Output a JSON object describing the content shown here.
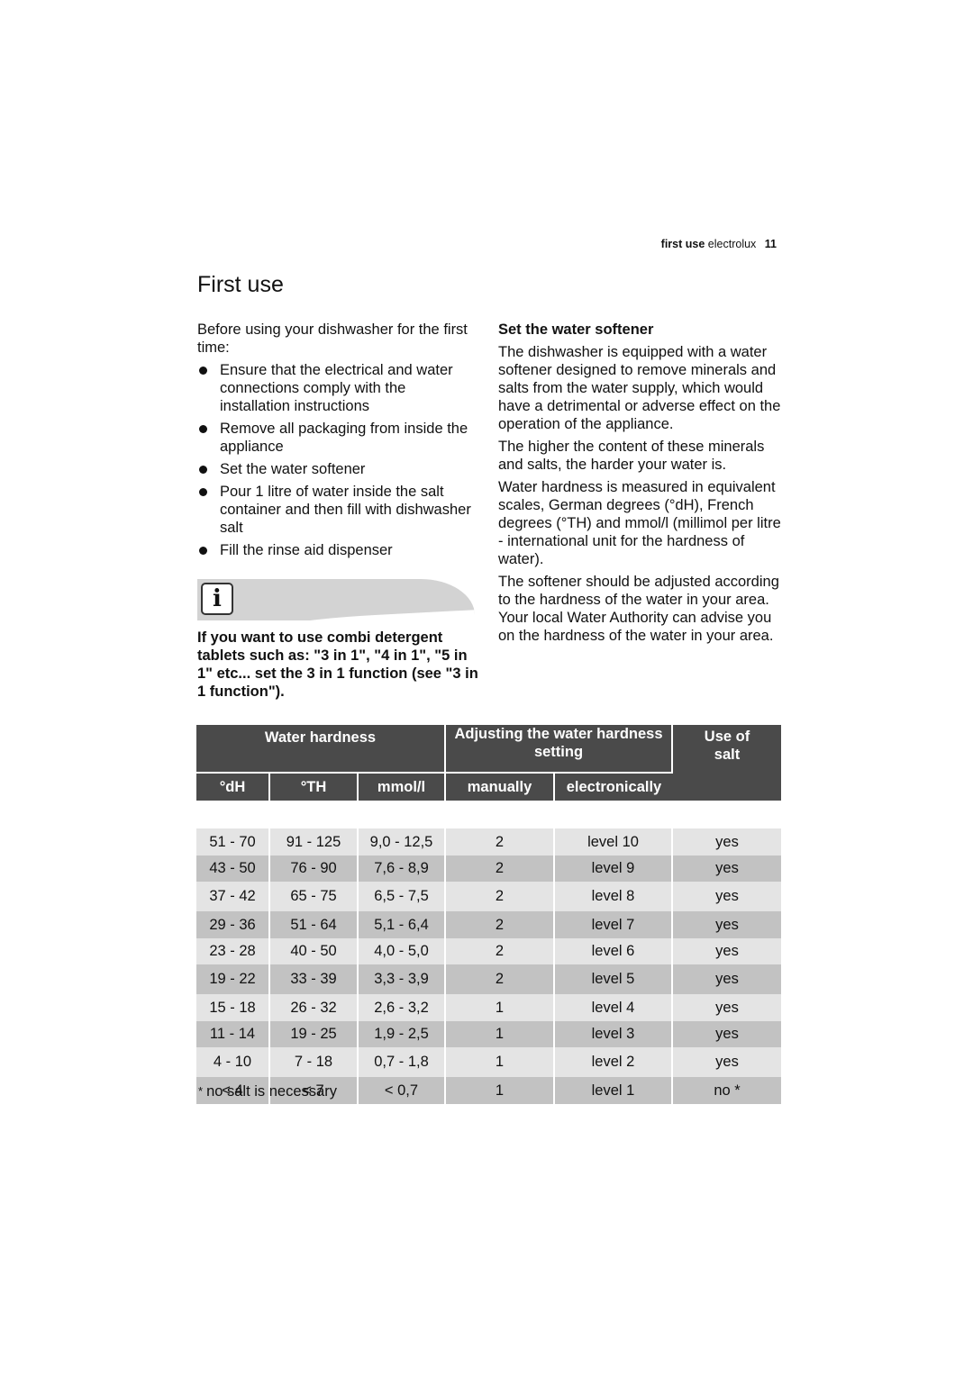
{
  "running_header": {
    "section": "first use",
    "brand": "electrolux",
    "page_number": "11"
  },
  "page_title": "First use",
  "left_column": {
    "intro": "Before using your dishwasher for the first time:",
    "bullets": [
      "Ensure that the electrical and water connections comply with the installation instructions",
      "Remove all packaging from inside the appliance",
      "Set the water softener",
      "Pour 1 litre of water inside the salt container and then fill with dishwasher salt",
      "Fill the rinse aid dispenser"
    ],
    "info_icon": "info-icon",
    "note": "If you want to use combi detergent tablets such as: \"3 in 1\", \"4 in 1\", \"5 in 1\" etc... set the 3 in 1 function (see \"3 in 1 function\")."
  },
  "right_column": {
    "heading": "Set the water softener",
    "paragraphs": [
      "The dishwasher is equipped with a water softener designed to remove minerals and salts from the water supply, which would have a detrimental or adverse effect on the operation of the appliance.",
      "The higher the content of these minerals and salts, the harder your water is.",
      "Water hardness is measured in equivalent scales, German degrees (°dH), French degrees (°TH) and mmol/l (millimol per litre - international unit for the hardness of water).",
      "The softener should be adjusted according to the hardness of the water in your area. Your local Water Authority can advise you on the hardness of the water in your area."
    ]
  },
  "table": {
    "group_headers": {
      "water_hardness": "Water hardness",
      "adjusting": "Adjusting the water hardness setting",
      "use_of_salt": "Use of salt"
    },
    "sub_headers": {
      "dh": "°dH",
      "th": "°TH",
      "mmol": "mmol/l",
      "manually": "manually",
      "electronically": "electronically"
    },
    "rows": [
      {
        "dh": "51 - 70",
        "th": "91 - 125",
        "mmol": "9,0 - 12,5",
        "manually": "2",
        "electronically": "level 10",
        "salt": "yes"
      },
      {
        "dh": "43 - 50",
        "th": "76 - 90",
        "mmol": "7,6 - 8,9",
        "manually": "2",
        "electronically": "level 9",
        "salt": "yes"
      },
      {
        "dh": "37 - 42",
        "th": "65 - 75",
        "mmol": "6,5 - 7,5",
        "manually": "2",
        "electronically": "level 8",
        "salt": "yes"
      },
      {
        "dh": "29 - 36",
        "th": "51 - 64",
        "mmol": "5,1 - 6,4",
        "manually": "2",
        "electronically": "level 7",
        "salt": "yes"
      },
      {
        "dh": "23 - 28",
        "th": "40 - 50",
        "mmol": "4,0 - 5,0",
        "manually": "2",
        "electronically": "level 6",
        "salt": "yes"
      },
      {
        "dh": "19 - 22",
        "th": "33 - 39",
        "mmol": "3,3 - 3,9",
        "manually": "2",
        "electronically": "level 5",
        "salt": "yes"
      },
      {
        "dh": "15 - 18",
        "th": "26 - 32",
        "mmol": "2,6 - 3,2",
        "manually": "1",
        "electronically": "level 4",
        "salt": "yes"
      },
      {
        "dh": "11 - 14",
        "th": "19 - 25",
        "mmol": "1,9 - 2,5",
        "manually": "1",
        "electronically": "level 3",
        "salt": "yes"
      },
      {
        "dh": "4 - 10",
        "th": "7 - 18",
        "mmol": "0,7 - 1,8",
        "manually": "1",
        "electronically": "level 2",
        "salt": "yes"
      },
      {
        "dh": "< 4",
        "th": "< 7",
        "mmol": "< 0,7",
        "manually": "1",
        "electronically": "level 1",
        "salt": "no *"
      }
    ]
  },
  "footnote": {
    "marker": "*",
    "text": "no salt is necessary"
  }
}
